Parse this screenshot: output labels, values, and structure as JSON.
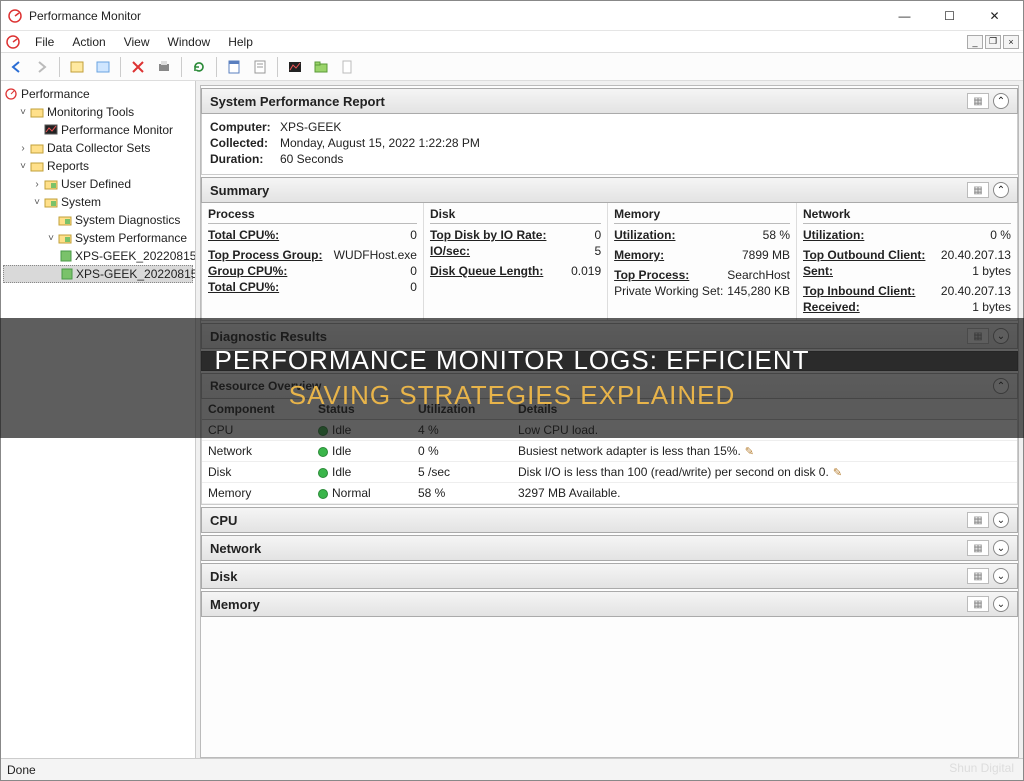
{
  "window": {
    "title": "Performance Monitor"
  },
  "menu": {
    "file": "File",
    "action": "Action",
    "view": "View",
    "window": "Window",
    "help": "Help"
  },
  "tree": {
    "root": "Performance",
    "monitoring_tools": "Monitoring Tools",
    "performance_monitor": "Performance Monitor",
    "data_collector_sets": "Data Collector Sets",
    "reports": "Reports",
    "user_defined": "User Defined",
    "system": "System",
    "system_diagnostics": "System Diagnostics",
    "system_performance": "System Performance",
    "rep1": "XPS-GEEK_20220815",
    "rep2": "XPS-GEEK_20220815"
  },
  "report": {
    "header": "System Performance Report",
    "computer_label": "Computer:",
    "computer_value": "XPS-GEEK",
    "collected_label": "Collected:",
    "collected_value": "Monday, August 15, 2022 1:22:28 PM",
    "duration_label": "Duration:",
    "duration_value": "60 Seconds"
  },
  "summary": {
    "header": "Summary",
    "process": {
      "hdr": "Process",
      "total_cpu_lbl": "Total CPU%:",
      "total_cpu_val": "0",
      "top_group_lbl": "Top Process Group:",
      "top_group_val": "WUDFHost.exe",
      "group_cpu_lbl": "Group CPU%:",
      "group_cpu_val": "0",
      "total_cpu2_lbl": "Total CPU%:",
      "total_cpu2_val": "0"
    },
    "disk": {
      "hdr": "Disk",
      "top_io_lbl": "Top Disk by IO Rate:",
      "top_io_val": "0",
      "iosec_lbl": "IO/sec:",
      "iosec_val": "5",
      "queue_lbl": "Disk Queue Length:",
      "queue_val": "0.019"
    },
    "memory": {
      "hdr": "Memory",
      "util_lbl": "Utilization:",
      "util_val": "58 %",
      "mem_lbl": "Memory:",
      "mem_val": "7899 MB",
      "top_proc_lbl": "Top Process:",
      "top_proc_val": "SearchHost",
      "pws_lbl": "Private Working Set:",
      "pws_val": "145,280 KB"
    },
    "network": {
      "hdr": "Network",
      "util_lbl": "Utilization:",
      "util_val": "0 %",
      "out_lbl": "Top Outbound Client:",
      "out_val": "20.40.207.13",
      "sent_lbl": "Sent:",
      "sent_val": "1 bytes",
      "in_lbl": "Top Inbound Client:",
      "in_val": "20.40.207.13",
      "recv_lbl": "Received:",
      "recv_val": "1 bytes"
    }
  },
  "diag": {
    "header": "Diagnostic Results"
  },
  "resource": {
    "header": "Resource Overview",
    "cols": {
      "component": "Component",
      "status": "Status",
      "utilization": "Utilization",
      "details": "Details"
    },
    "rows": [
      {
        "comp": "CPU",
        "status": "Idle",
        "util": "4 %",
        "details": "Low CPU load."
      },
      {
        "comp": "Network",
        "status": "Idle",
        "util": "0 %",
        "details": "Busiest network adapter is less than 15%."
      },
      {
        "comp": "Disk",
        "status": "Idle",
        "util": "5 /sec",
        "details": "Disk I/O is less than 100 (read/write) per second on disk 0."
      },
      {
        "comp": "Memory",
        "status": "Normal",
        "util": "58 %",
        "details": "3297 MB Available."
      }
    ]
  },
  "sections": {
    "cpu": "CPU",
    "network": "Network",
    "disk": "Disk",
    "memory": "Memory"
  },
  "status": "Done",
  "overlay": {
    "line1": "PERFORMANCE MONITOR LOGS: EFFICIENT",
    "line2": "SAVING STRATEGIES EXPLAINED"
  },
  "watermark": "Shun Digital"
}
